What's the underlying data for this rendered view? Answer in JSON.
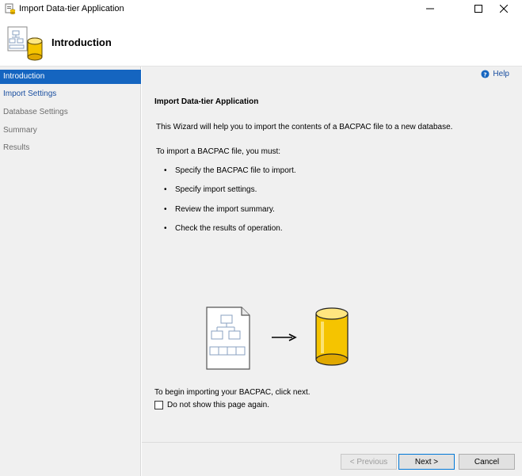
{
  "window": {
    "title": "Import Data-tier Application"
  },
  "header": {
    "title": "Introduction"
  },
  "sidebar": {
    "items": [
      {
        "label": "Introduction",
        "state": "active"
      },
      {
        "label": "Import Settings",
        "state": "link"
      },
      {
        "label": "Database Settings",
        "state": "dim"
      },
      {
        "label": "Summary",
        "state": "dim"
      },
      {
        "label": "Results",
        "state": "dim"
      }
    ]
  },
  "content": {
    "help_label": "Help",
    "section_title": "Import Data-tier Application",
    "intro": "This Wizard will help you to import the contents of a BACPAC file to a new database.",
    "requirements_heading": "To import a BACPAC file, you must:",
    "bullets": [
      "Specify the BACPAC file to import.",
      "Specify import settings.",
      "Review the import summary.",
      "Check the results of operation."
    ],
    "begin_text": "To begin importing your BACPAC, click next.",
    "checkbox_label": "Do not show this page again."
  },
  "footer": {
    "previous_label": "< Previous",
    "next_label": "Next >",
    "cancel_label": "Cancel"
  },
  "colors": {
    "accent": "#1565c0",
    "link": "#1a4fa0",
    "cylinder": "#f5c400"
  }
}
